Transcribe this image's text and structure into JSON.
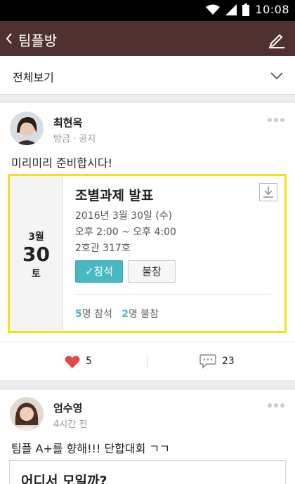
{
  "status": {
    "time": "10:08"
  },
  "appbar": {
    "title": "팀플방"
  },
  "filter": {
    "label": "전체보기"
  },
  "posts": [
    {
      "author": "최현옥",
      "meta": "방금 · 공지",
      "body": "미리미리 준비합시다!",
      "event": {
        "month": "3월",
        "day": "30",
        "weekday": "토",
        "title": "조별과제 발표",
        "date": "2016년 3월 30일 (수)",
        "time": "오후 2:00 ~ 오후 4:00",
        "place": "2호관 317호",
        "attend_label": "참석",
        "absent_label": "불참",
        "attend_count": "5",
        "attend_suffix": "명 참석",
        "absent_count": "2",
        "absent_suffix": "명 불참"
      },
      "likes": "5",
      "comments": "23"
    },
    {
      "author": "엄수영",
      "meta": "4시간 전",
      "body": "팀플 A+를 향해!!! 단합대회 ㄱㄱ",
      "card_title": "어디서 모일까?"
    }
  ],
  "colors": {
    "appbar": "#4f3131",
    "highlight": "#f2e21d",
    "accent": "#47b8c4",
    "like": "#e84545"
  }
}
